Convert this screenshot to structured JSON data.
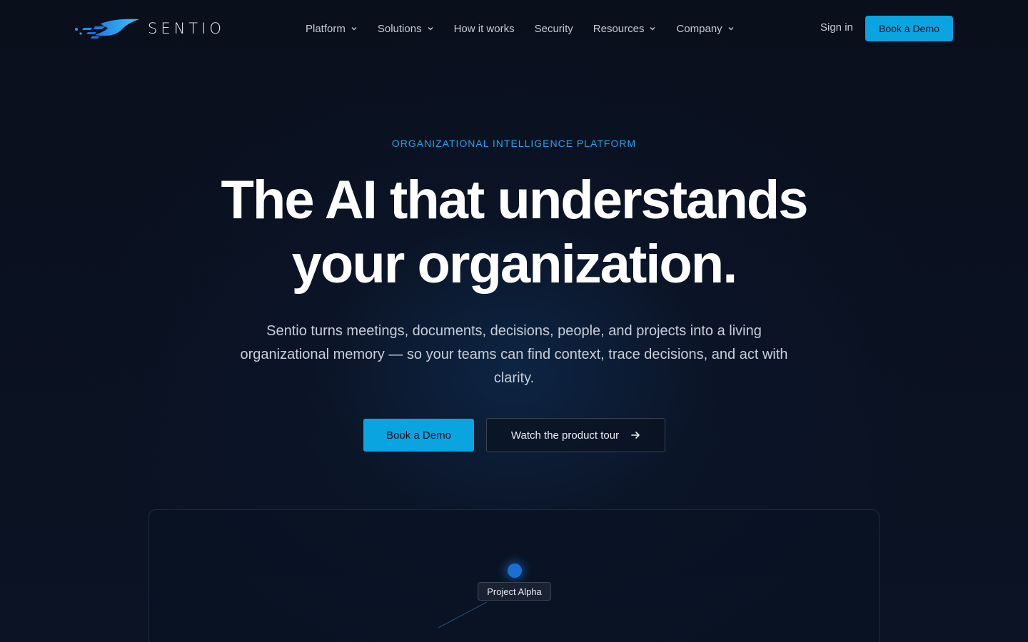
{
  "brand": {
    "name": "SENTIO",
    "accent": "#0aa5e0"
  },
  "nav": {
    "items": [
      {
        "label": "Platform",
        "dropdown": true
      },
      {
        "label": "Solutions",
        "dropdown": true
      },
      {
        "label": "How it works",
        "dropdown": false
      },
      {
        "label": "Security",
        "dropdown": false
      },
      {
        "label": "Resources",
        "dropdown": true
      },
      {
        "label": "Company",
        "dropdown": true
      }
    ],
    "signin_label": "Sign in",
    "demo_label": "Book a Demo"
  },
  "hero": {
    "eyebrow": "ORGANIZATIONAL INTELLIGENCE PLATFORM",
    "headline_line1": "The AI that understands",
    "headline_line2": "your organization.",
    "subtext": "Sentio turns meetings, documents, decisions, people, and projects into a living organizational memory — so your teams can find context, trace decisions, and act with clarity.",
    "primary_cta": "Book a Demo",
    "secondary_cta": "Watch the product tour"
  },
  "graph": {
    "node_label": "Project Alpha"
  }
}
